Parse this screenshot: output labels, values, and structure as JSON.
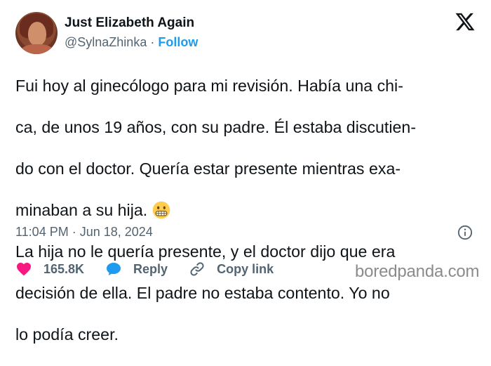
{
  "author": {
    "display_name": "Just Elizabeth Again",
    "handle": "@SylnaZhinka",
    "separator": "·",
    "follow_label": "Follow"
  },
  "tweet": {
    "lines": [
      "Fui hoy al ginecólogo para mi revisión. Había una chi-",
      "ca, de unos 19 años, con su padre. Él estaba discutien-",
      "do con el doctor. Quería estar presente mientras exa-",
      "minaban a su hija.",
      "La hija no le quería presente, y el doctor dijo que era",
      "decisión de ella. El padre no estaba contento. Yo no",
      "lo podía creer."
    ],
    "emoji_name": "grimacing-face-icon",
    "timestamp": "11:04 PM · Jun 18, 2024"
  },
  "actions": {
    "like_count": "165.8K",
    "reply_label": "Reply",
    "copy_link_label": "Copy link"
  },
  "watermark": "boredpanda.com",
  "colors": {
    "text": "#0f1419",
    "secondary": "#536471",
    "accent": "#1d9bf0",
    "like": "#f91880",
    "reply": "#1d9bf0",
    "watermark": "#8b8b8b"
  }
}
